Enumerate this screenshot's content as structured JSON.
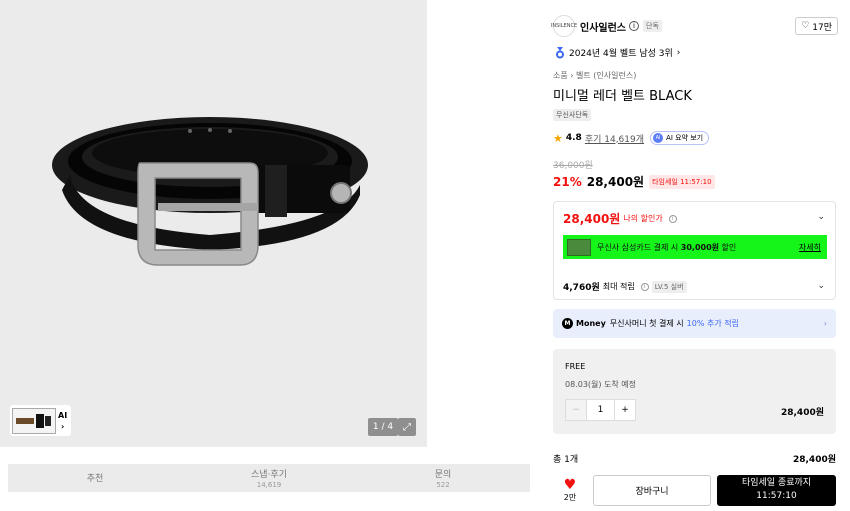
{
  "gallery": {
    "thumb_ai_label": "AI",
    "counter": "1 / 4",
    "expand_icon": "expand-icon"
  },
  "tabs": [
    {
      "label": "추천",
      "sub": ""
    },
    {
      "label": "스냅·후기",
      "sub": "14,619"
    },
    {
      "label": "문의",
      "sub": "522"
    }
  ],
  "brand": {
    "logo_text": "INSILENCE",
    "name": "인사일런스",
    "badge": "단독",
    "likes": "17만"
  },
  "rank": "2024년 4월 벨트 남성 3위",
  "breadcrumb": "소품 › 벨트 (인사일런스)",
  "title": "미니멀 레더 벨트 BLACK",
  "exclusive_badge": "무신사단독",
  "review": {
    "rating": "4.8",
    "count_label": "후기 14,619개",
    "ai_summary": "AI 요약 보기"
  },
  "pricing": {
    "original": "36,000원",
    "discount": "21%",
    "price": "28,400원",
    "timer": "타임세일 11:57:10"
  },
  "benefit": {
    "my_price": "28,400원",
    "my_price_label": "나의 할인가",
    "card_text_prefix": "무신사 삼성카드 결제 시 ",
    "card_text_bold": "30,000원",
    "card_text_suffix": " 할인",
    "card_more": "자세히",
    "points_amount": "4,760원",
    "points_label": "최대 적립",
    "level": "LV.5 실버"
  },
  "money": {
    "logo": "M",
    "name": "Money",
    "text": "무신사머니 첫 결제 시",
    "highlight": "10% 추가 적립"
  },
  "option": {
    "free": "FREE",
    "arrival": "08.03(월) 도착 예정",
    "quantity": "1",
    "price": "28,400원"
  },
  "total": {
    "label": "총 1개",
    "price": "28,400원"
  },
  "actions": {
    "heart_count": "2만",
    "cart": "장바구니",
    "buy_line1": "타임세일 종료까지",
    "buy_line2": "11:57:10"
  },
  "colors": {
    "accent_red": "#f31110",
    "promo_green": "#15f51a",
    "money_blue": "#3c68f5"
  }
}
